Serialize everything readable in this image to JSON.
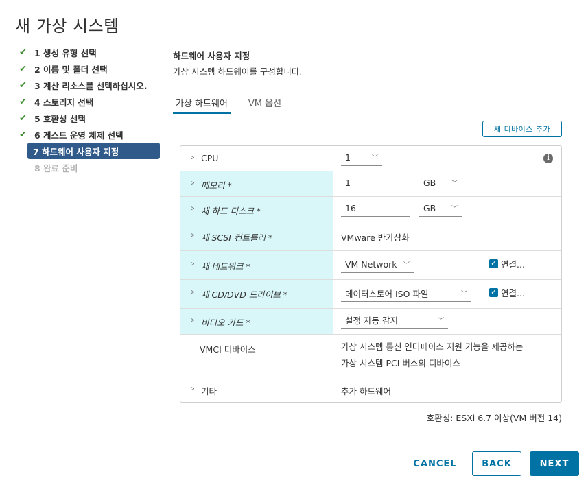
{
  "dialog": {
    "title": "새 가상 시스템"
  },
  "steps": [
    {
      "label": "1 생성 유형 선택",
      "state": "done"
    },
    {
      "label": "2 이름 및 폴더 선택",
      "state": "done"
    },
    {
      "label": "3 계산 리소스를 선택하십시오.",
      "state": "done"
    },
    {
      "label": "4 스토리지 선택",
      "state": "done"
    },
    {
      "label": "5 호환성 선택",
      "state": "done"
    },
    {
      "label": "6 게스트 운영 체제 선택",
      "state": "done"
    },
    {
      "label": "7 하드웨어 사용자 지정",
      "state": "active"
    },
    {
      "label": "8 완료 준비",
      "state": "disabled"
    }
  ],
  "content": {
    "title": "하드웨어 사용자 지정",
    "subtitle": "가상 시스템 하드웨어를 구성합니다."
  },
  "tabs": [
    {
      "label": "가상 하드웨어",
      "active": true
    },
    {
      "label": "VM 옵션",
      "active": false
    }
  ],
  "add_device": {
    "label": "새 디바이스 추가"
  },
  "hardware": {
    "cpu": {
      "label": "CPU",
      "value": "1"
    },
    "memory": {
      "label": "메모리 *",
      "value": "1",
      "unit": "GB"
    },
    "disk": {
      "label": "새 하드 디스크 *",
      "value": "16",
      "unit": "GB"
    },
    "scsi": {
      "label": "새 SCSI 컨트롤러 *",
      "value": "VMware 반가상화"
    },
    "network": {
      "label": "새 네트워크 *",
      "value": "VM Network",
      "connect": "연결..."
    },
    "cddvd": {
      "label": "새 CD/DVD 드라이브 *",
      "value": "데이터스토어 ISO 파일",
      "connect": "연결..."
    },
    "video": {
      "label": "비디오 카드 *",
      "value": "설정 자동 감지"
    },
    "vmci": {
      "label": "VMCI 디바이스",
      "line1": "가상 시스템 통신 인터페이스 지원 기능을 제공하는",
      "line2": "가상 시스템 PCI 버스의 디바이스"
    },
    "other": {
      "label": "기타",
      "value": "추가 하드웨어"
    }
  },
  "compatibility": "호환성: ESXi 6.7 이상(VM 버전 14)",
  "buttons": {
    "cancel": "CANCEL",
    "back": "BACK",
    "next": "NEXT"
  },
  "colors": {
    "accent": "#0072a3",
    "active_step": "#2f5a8a",
    "invalid_row": "#d9f7f9",
    "check": "#3c8c2f"
  },
  "icons": {
    "step_done": "checkmark-icon",
    "expand": "chevron-right-icon",
    "dropdown": "chevron-down-icon",
    "info": "info-icon",
    "checkbox": "checkbox-checked-icon"
  }
}
